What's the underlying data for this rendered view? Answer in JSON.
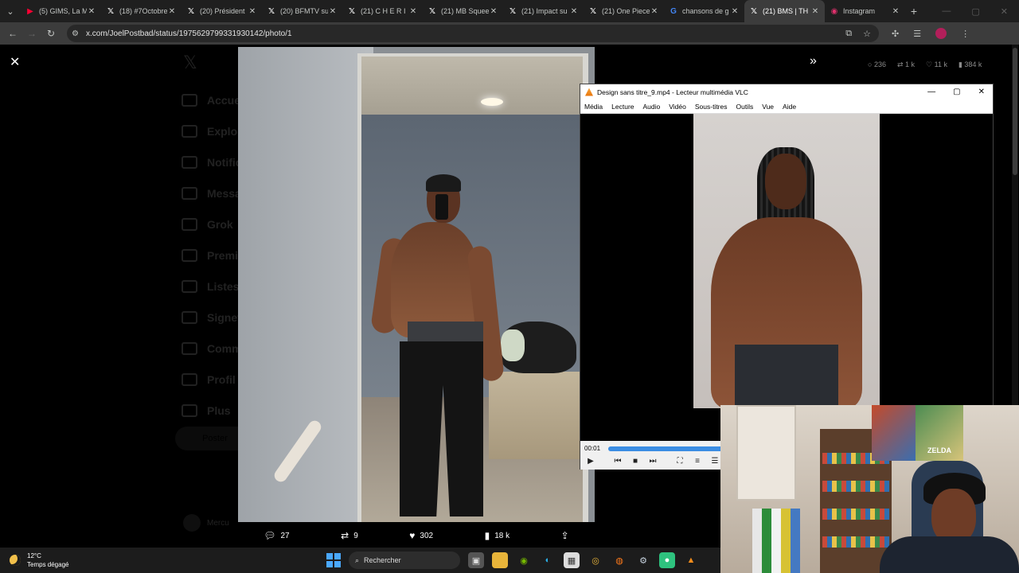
{
  "browser": {
    "tabs": [
      {
        "icon": "youtube-icon",
        "label": "(5) GIMS, La M",
        "color": "#ff0033",
        "active": false
      },
      {
        "icon": "x-logo-icon",
        "label": "(18) #7Octobre",
        "color": "#ffffff",
        "active": false
      },
      {
        "icon": "x-logo-icon",
        "label": "(20) Président",
        "color": "#ffffff",
        "active": false
      },
      {
        "icon": "x-logo-icon",
        "label": "(20) BFMTV su",
        "color": "#ffffff",
        "active": false
      },
      {
        "icon": "x-logo-icon",
        "label": "(21) C H E R I",
        "color": "#ffffff",
        "active": false
      },
      {
        "icon": "x-logo-icon",
        "label": "(21) MB Squee",
        "color": "#ffffff",
        "active": false
      },
      {
        "icon": "x-logo-icon",
        "label": "(21) Impact su",
        "color": "#ffffff",
        "active": false
      },
      {
        "icon": "x-logo-icon",
        "label": "(21) One Piece",
        "color": "#ffffff",
        "active": false
      },
      {
        "icon": "google-icon",
        "label": "chansons de g",
        "color": "#4285f4",
        "active": false
      },
      {
        "icon": "x-logo-icon",
        "label": "(21) BMS | TH",
        "color": "#ffffff",
        "active": true
      },
      {
        "icon": "instagram-icon",
        "label": "Instagram",
        "color": "#e1306c",
        "active": false
      }
    ],
    "url": "x.com/JoelPostbad/status/1975629799331930142/photo/1"
  },
  "x_page": {
    "nav": [
      "Accueil",
      "Explorer",
      "Notifications",
      "Messages",
      "Grok",
      "Premium",
      "Listes",
      "Signets",
      "Communautés",
      "Profil",
      "Plus"
    ],
    "post_button": "Poster",
    "profile_name": "Mercu",
    "top_stats": {
      "replies": "236",
      "reposts": "1 k",
      "likes": "11 k",
      "views": "384 k"
    },
    "photo_actions": {
      "replies": "27",
      "reposts": "9",
      "likes": "302",
      "views": "18 k"
    }
  },
  "vlc": {
    "title": "Design sans titre_9.mp4 - Lecteur multimédia VLC",
    "menu": [
      "Média",
      "Lecture",
      "Audio",
      "Vidéo",
      "Sous-titres",
      "Outils",
      "Vue",
      "Aide"
    ],
    "time": "00:01",
    "progress": 0.99,
    "accent": "#3b8de3"
  },
  "webcam": {
    "poster_text": "ZELDA"
  },
  "taskbar": {
    "temperature": "12°C",
    "weather": "Temps dégagé",
    "search_placeholder": "Rechercher"
  }
}
